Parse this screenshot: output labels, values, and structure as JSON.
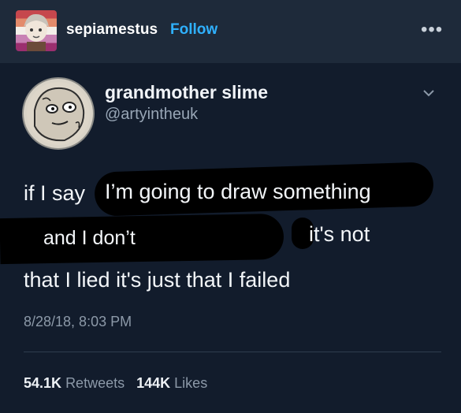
{
  "header": {
    "username": "sepiamestus",
    "follow_label": "Follow",
    "more_label": "•••",
    "avatar_icon": "user-avatar-icon"
  },
  "tweet": {
    "author_name": "grandmother slime",
    "handle": "@artyintheuk",
    "line1_a": "if I say",
    "line1_b": "I’m going to draw something",
    "line2_a": "and I don’t",
    "line2_b": "it's not",
    "line3": "that I lied it's just that I failed",
    "timestamp": "8/28/18, 8:03 PM",
    "retweets_count": "54.1K",
    "retweets_label": "Retweets",
    "likes_count": "144K",
    "likes_label": "Likes"
  },
  "colors": {
    "header_bg": "#1e2a3a",
    "tweet_bg": "#121c2c",
    "follow": "#2fb1ff",
    "muted": "#8c99a8"
  }
}
